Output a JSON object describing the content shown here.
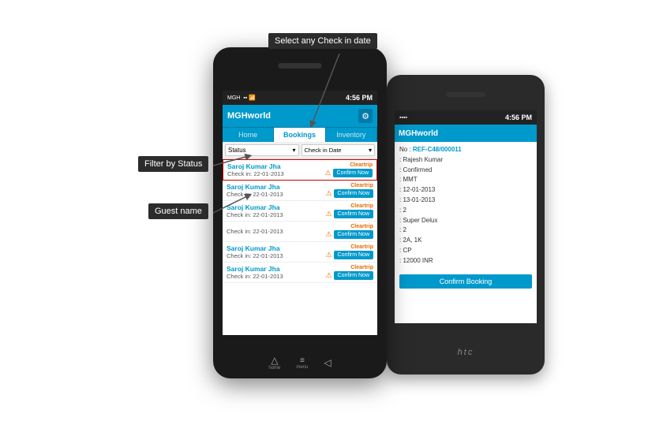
{
  "annotations": {
    "checkin_label": "Select any Check in date",
    "filter_label": "Filter by Status",
    "guest_label": "Guest name"
  },
  "phone1": {
    "status_bar": {
      "time": "4:56 PM",
      "network": "MGH"
    },
    "header": {
      "app_name": "MGHworld",
      "gear": "⚙"
    },
    "nav": {
      "tabs": [
        "Home",
        "Bookings",
        "Inventory"
      ]
    },
    "filters": {
      "status": "Status",
      "checkin": "Check in Date"
    },
    "bookings": [
      {
        "name": "Saroj Kumar Jha",
        "checkin": "Check in: 22-01-2013",
        "source": "Cleartrip",
        "btn": "Confirm Now",
        "highlighted": true
      },
      {
        "name": "Saroj Kumar Jha",
        "checkin": "Check in: 22-01-2013",
        "source": "Cleartrip",
        "btn": "Confirm Now",
        "highlighted": false
      },
      {
        "name": "Saroj Kumar Jha",
        "checkin": "Check in: 22-01-2013",
        "source": "Cleartrip",
        "btn": "Confirm Now",
        "highlighted": false
      },
      {
        "name": "",
        "checkin": "Check in: 22-01-2013",
        "source": "Cleartrip",
        "btn": "Confirm Now",
        "highlighted": false
      },
      {
        "name": "Saroj Kumar Jha",
        "checkin": "Check in: 22-01-2013",
        "source": "Cleartrip",
        "btn": "Confirm Now",
        "highlighted": false
      },
      {
        "name": "Saroj Kumar Jha",
        "checkin": "Check in: 22-01-2013",
        "source": "Cleartrip",
        "btn": "Confirm Now",
        "highlighted": false
      }
    ]
  },
  "phone2": {
    "status_bar": {
      "time": "4:56 PM"
    },
    "header": {
      "app_name": "MGHworld"
    },
    "detail": {
      "no_label": "No :",
      "ref": "REF-C48/000011",
      "fields": [
        {
          "label": "",
          "value": "Rajesh Kumar"
        },
        {
          "label": "",
          "value": "Confirmed"
        },
        {
          "label": "",
          "value": "MMT"
        },
        {
          "label": "",
          "value": "12-01-2013"
        },
        {
          "label": "",
          "value": "13-01-2013"
        },
        {
          "label": "",
          "value": "2"
        },
        {
          "label": "",
          "value": "Super Delux"
        },
        {
          "label": "",
          "value": "2"
        },
        {
          "label": "",
          "value": "2A, 1K"
        },
        {
          "label": "",
          "value": "CP"
        },
        {
          "label": "",
          "value": "12000 INR"
        }
      ],
      "confirm_btn": "Confirm Booking"
    },
    "htc": "htc"
  }
}
